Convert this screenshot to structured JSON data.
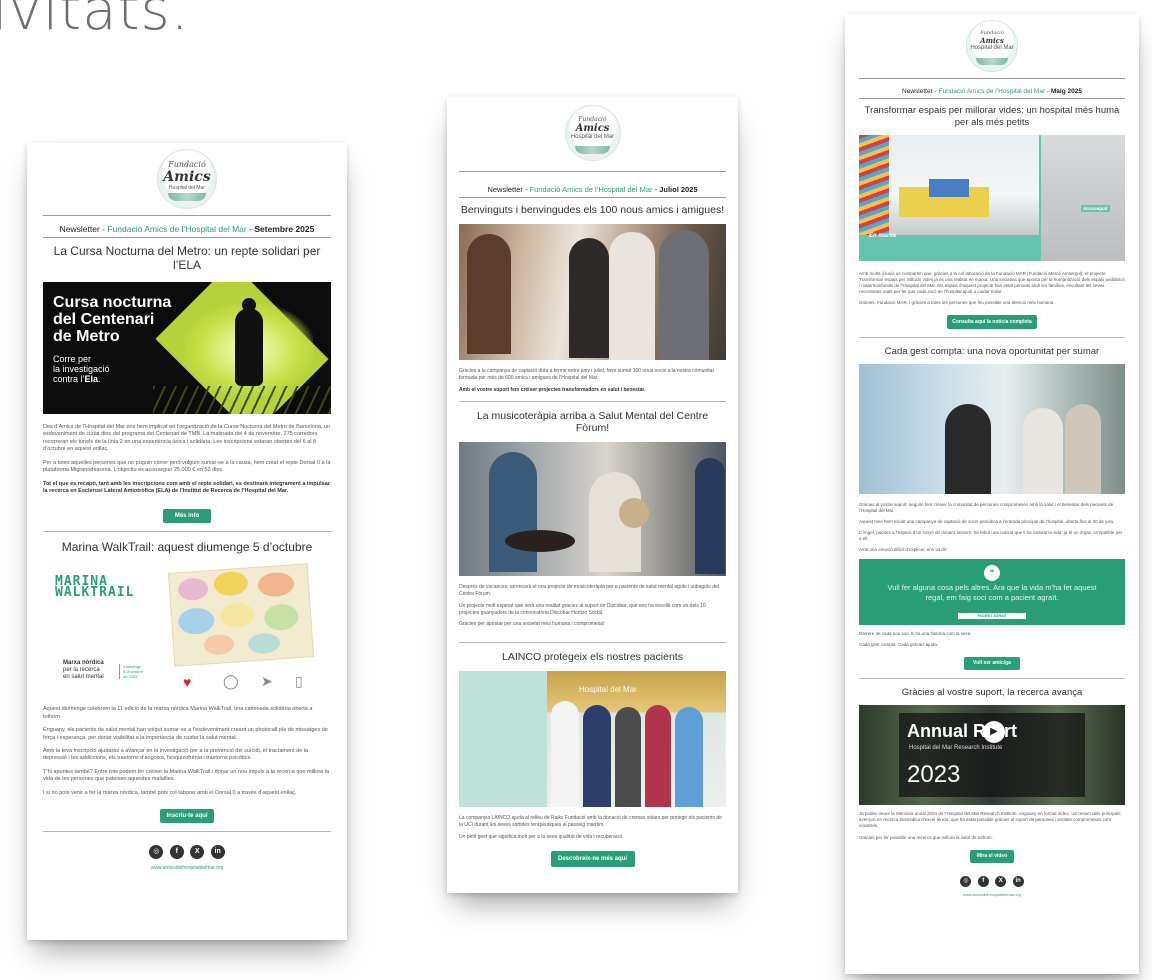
{
  "page": {
    "heading_fragment": "ivitats."
  },
  "colors": {
    "accent": "#2a9e76",
    "text": "#333333",
    "rule": "#9a9a9a"
  },
  "logo": {
    "line1": "Fundació",
    "line2": "Amics",
    "line3": "Hospital del Mar"
  },
  "cards": [
    {
      "newsletter_label": "Newsletter",
      "brand": "Fundació Amics de l’Hospital del Mar",
      "date": "Setembre 2025",
      "sections": [
        {
          "title": "La Cursa Nocturna del Metro: un repte solidari per l’ELA",
          "banner_title_lines": [
            "Cursa nocturna",
            "del Centenari",
            "de Metro"
          ],
          "banner_sub_lines": [
            "Corre per",
            "la investigació",
            "contra l’"
          ],
          "banner_sub_bold": "Ela",
          "paragraphs": [
            "Des d’Amics de l’Hospital del Mar ens hem implicat en l’organització de la Curse Nocturna del Metro de Barcelona, un esdeveniment de ciutat dins del programa del Centenari de TMB. La matinada del 4 de novembre, 275 corredors recorreran els túnels de la línia 2 en una experiència única i solidària. Les inscripcions estaran obertes del 6 al 8 d’octubre en aquest enllaç.",
            "Per a totes aquelles persones que no puguin córrer però vulguin sumar-se a la causa, hem creat el repte Dorsal 0 a la plataforma Migranodearena. L’objectiu és aconseguir 25.000 € en 53 dies.",
            "Tot el que es recapti, tant amb les inscripcions com amb el repte solidari, es destinarà íntegrament a impulsar la recerca en Esclerosi Lateral Amiotròfica (ELA) de l’Institut de Recerca de l’Hospital del Mar."
          ],
          "button": "Més info"
        },
        {
          "title": "Marina WalkTrail: aquest diumenge 5 d’octubre",
          "banner_logo_lines": [
            "MARINA",
            "WALKTRAIL"
          ],
          "banner_sub_lines": [
            "per la recerca",
            "en salut mental"
          ],
          "banner_sub_bold": "Marxa nòrdica",
          "banner_date_lines": [
            "Diumenge",
            "5 d’octubre",
            "de 2025"
          ],
          "paragraphs": [
            "Aquest diumenge celebrem la 11 edició de la marxa nòrdica Marina WalkTrail, una caminada solidària oberta a tothom.",
            "Enguany, els pacients de salut mental han volgut sumar-se a l’esdeveniment creant un photocall ple de missatges de força i esperança, per donar visibilitat a la importància de cuidar la salut mental.",
            "Amb la teva inscripció ajudaràs a avançar en la investigació per a la prevenció del suïcidi, el tractament de la depressió i les addiccions, els trastorns d’angoixa, l’esquizofrènia i trastorns psicòtics.",
            "T’hi apuntes també? Entre tots podem fer créixer la Marina WalkTrail i donar un nou impuls a la recerca que millora la vida de les persones que pateixen aquestes malalties.",
            "I si no pots venir a fer la marxa nòrdica, també pots col·laborar amb el Dorsal 0 a través d’aquest enllaç."
          ],
          "button": "Inscriu-te aquí"
        }
      ],
      "social": [
        "◎",
        "f",
        "X",
        "in"
      ],
      "website": "www.amicsdelhospitaldelmar.org"
    },
    {
      "newsletter_label": "Newsletter",
      "brand": "Fundació Amics de l’Hospital del Mar",
      "date": "Juliol 2025",
      "sections": [
        {
          "title": "Benvinguts i benvingudes els 100 nous amics i amigues!",
          "paragraphs": [
            "Gràcies a la campanya de captació duta a terme entre juny i juliol, hem sumat 100 nous socis a la nostra comunitat formada per més de 600 amics i amigues de l’Hospital del Mar.",
            "Amb el vostre suport fem créixer projectes transformadors en salut i benestar."
          ]
        },
        {
          "title": "La musicoteràpia arriba a Salut Mental del Centre Fòrum!",
          "paragraphs": [
            "Després de vacances, arrencarà el nou projecte de musicoteràpia per a pacients de salut mental aguts i subaguts del Centre Fòrum.",
            "Un projecte molt esperat que serà una realitat gràcies al suport de Discobar, que ens ha escollit com un dels 10 projectes guanyadors de la convocatòria Discobar Horitzó Social.",
            "Gràcies per apostar per una societat més humana i compromesa!"
          ]
        },
        {
          "title": "LAINCO protegeix els nostres pacients",
          "photo_sign": "Hospital del Mar",
          "paragraphs": [
            "La companyia LAINCO ajuda al relleu de Raiks Fundació amb la donació de cremes solars per protegir els pacients de la UCI durant les seves sortides terapèutiques al passeig marítim.",
            "Un petit gest que significa molt per a la seva qualitat de vida i recuperació."
          ],
          "button": "Descobreix-ne més aquí"
        }
      ]
    },
    {
      "newsletter_label": "Newsletter",
      "brand": "Fundació Amics de l’Hospital del Mar",
      "date": "Maig 2025",
      "sections": [
        {
          "title": "Transformar espais per millorar vides: un hospital més humà per als més petits",
          "photo_label_left": "En marxa",
          "photo_label_right": "Aconseguit",
          "paragraphs": [
            "Amb molta il·lusió us compartim que, gràcies a la col·laboració de la Fundació MAR (Fundació Mercè Amsergol), el projecte Transformar espais per millorar vides ja és una realitat en marxa. Una iniciativa que aposta per la humanització dels espais pediàtrics i maternoinfantils de l’Hospital del Mar. Els espais d’aquest projecte han estat pensats amb les famílies, escoltant les seves necessitats reals per fer que cada racó de l’hospital ajudi a cuidar millor.",
            "Gràcies, Fundació MAR, i gràcies a totes les persones que feu possible una atenció més humana."
          ],
          "button": "Consulta aquí la notícia completa"
        },
        {
          "title": "Cada gest compta: una nova oportunitat per sumar",
          "paragraphs": [
            "Gràcies al vostre suport, seguim fent créixer la comunitat de persones compromeses amb la salut i el benestar dels pacients de l’Hospital del Mar.",
            "Aquest mes hem iniciat una campanya de captació de socis periòdica a l’entrada principal de l’hospital, oberta fins al 30 de juny.",
            "L’Àngel, pacient a l’espera d’un ronyó de donant anònim, ha rebut una notícia que li ha canviat la vida: ja té un òrgan compatible per a ell.",
            "Amb una emoció difícil d’explicar, ens va dir:"
          ],
          "quote": "Vull fer alguna cosa pels altres. Ara que la vida m’ha fet aquest regal, em faig soci com a pacient agraït.",
          "quote_sign": "PACIENT AGRAÏT",
          "paragraphs_after": [
            "Darrere de cada nou soci hi ha una història com la seva.",
            "Cada gest compta. Cada gràcies ajuda."
          ],
          "button": "Vull ser amic/ga"
        },
        {
          "title": "Gràcies al vostre suport, la recerca avança",
          "video_title_a": "Annual R",
          "video_title_b": "rt",
          "video_sub": "Hospital del Mar Research Institute",
          "video_year": "2023",
          "paragraphs": [
            "Ja podeu veure la Memòria anual 2024 de l’Hospital del Mar Research Institute, enguany en format vídeo. Un resum dels principals avenços en recerca biomèdica d’excel·lència, que ha estat possible gràcies al suport de persones i entitats compromeses com vosaltres.",
            "Gràcies per fer possible una recerca que millora la salut de tothom."
          ],
          "button": "Mira el vídeo"
        }
      ],
      "social": [
        "◎",
        "f",
        "X",
        "in"
      ],
      "website": "www.amicsdelhospitaldelmar.org"
    }
  ]
}
